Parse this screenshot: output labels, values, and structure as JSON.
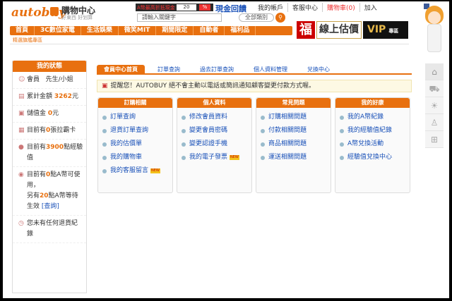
{
  "header": {
    "logo_text": "autobuy",
    "mall_title": "購物中心",
    "mall_sub": "好東西 好划算",
    "promo_tag": "A幣最高折抵現金",
    "promo_pct": "20",
    "promo_pct_sign": "%",
    "cash_label": "現金回饋",
    "links": [
      "我的帳戶",
      "客服中心",
      "購物車(0)",
      "加入"
    ],
    "search_placeholder": "請輸入關鍵字",
    "search_category": "全部類別"
  },
  "nav": {
    "items": [
      "首頁",
      "3C數位家電",
      "生活娛樂",
      "微笑MIT",
      "期間限定",
      "自動者",
      "福利品"
    ],
    "sub": "精選旗艦專區"
  },
  "banners": {
    "fu": "福",
    "gujia": "線上估價",
    "vip": "VIP",
    "vip_sub": "專區"
  },
  "sidebar": {
    "title": "我的狀態",
    "member_line1": "會員",
    "member_line2": "先生/小姐",
    "total_label": "累計金額",
    "total_value": "3262",
    "total_unit": "元",
    "deposit_label": "儲值金",
    "deposit_value": "0",
    "deposit_unit": "元",
    "coupon_prefix": "目前有",
    "coupon_value": "0",
    "coupon_suffix": "張拉霸卡",
    "exp_prefix": "目前有",
    "exp_value": "3900",
    "exp_suffix": "點經驗值",
    "abi_prefix": "目前有",
    "abi_value": "0",
    "abi_suffix": "點A幣可使用，",
    "abi_pending_prefix": "另有",
    "abi_pending_value": "20",
    "abi_pending_suffix": "點A幣等待生效",
    "abi_query": "[查詢]",
    "return_text": "您未有任何退貨紀錄"
  },
  "tabs": [
    "會員中心首頁",
    "訂單查詢",
    "過去訂單查詢",
    "個人資料管理",
    "兌換中心"
  ],
  "notice": "提醒您！AUTOBUY 絕不會主動以電話或簡訊通知顧客變更付款方式喔。",
  "boxes": [
    {
      "title": "訂購相關",
      "items": [
        "訂單查詢",
        "退貨訂單查詢",
        "我的估價單",
        "我的購物車",
        "我的客服留言"
      ],
      "new_index": 4
    },
    {
      "title": "個人資料",
      "items": [
        "修改會員資料",
        "變更會員密碼",
        "變更認證手機",
        "我的電子發票"
      ],
      "new_index": 3
    },
    {
      "title": "常見問題",
      "items": [
        "訂購相關問題",
        "付款相關問題",
        "商品相關問題",
        "運送相關問題"
      ],
      "new_index": -1
    },
    {
      "title": "我的好康",
      "items": [
        "我的A幣紀錄",
        "我的經驗值紀錄",
        "A幣兌換活動",
        "經驗值兌換中心"
      ],
      "new_index": -1
    }
  ],
  "new_badge": "NEW",
  "colors": {
    "accent": "#e8700f",
    "link": "#1850b8"
  }
}
